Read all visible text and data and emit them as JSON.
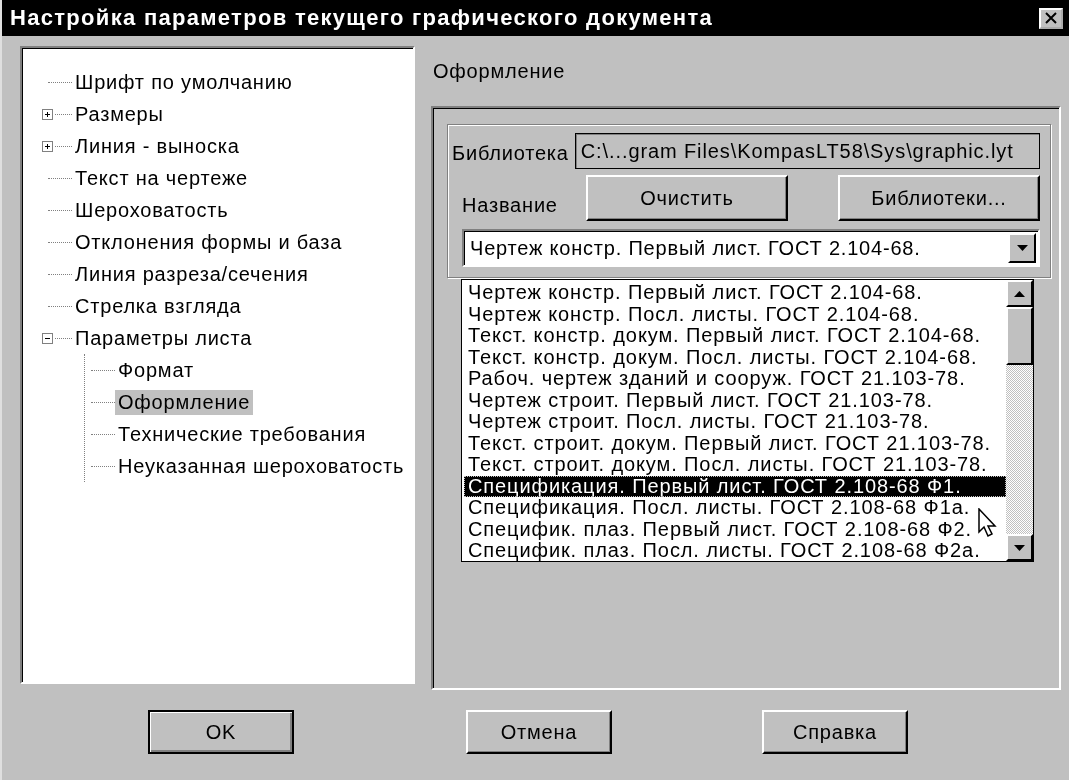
{
  "window": {
    "title": "Настройка параметров текущего графического документа"
  },
  "tree": {
    "items": [
      {
        "label": "Шрифт по умолчанию",
        "kind": "leaf",
        "selected": false
      },
      {
        "label": "Размеры",
        "kind": "group",
        "expanded": false,
        "selected": false
      },
      {
        "label": "Линия - выноска",
        "kind": "group",
        "expanded": false,
        "selected": false
      },
      {
        "label": "Текст на чертеже",
        "kind": "leaf",
        "selected": false
      },
      {
        "label": "Шероховатость",
        "kind": "leaf",
        "selected": false
      },
      {
        "label": "Отклонения формы и база",
        "kind": "leaf",
        "selected": false
      },
      {
        "label": "Линия разреза/сечения",
        "kind": "leaf",
        "selected": false
      },
      {
        "label": "Стрелка взгляда",
        "kind": "leaf",
        "selected": false
      },
      {
        "label": "Параметры листа",
        "kind": "group",
        "expanded": true,
        "selected": false,
        "children": [
          {
            "label": "Формат",
            "kind": "leaf",
            "selected": false
          },
          {
            "label": "Оформление",
            "kind": "leaf",
            "selected": true
          },
          {
            "label": "Технические требования",
            "kind": "leaf",
            "selected": false
          },
          {
            "label": "Неуказанная шероховатость",
            "kind": "leaf",
            "selected": false
          }
        ]
      }
    ]
  },
  "panel": {
    "title": "Оформление",
    "library_label": "Библиотека",
    "library_path": "C:\\...gram Files\\KompasLT58\\Sys\\graphic.lyt",
    "name_label": "Название",
    "buttons": [
      "Очистить",
      "Библиотеки..."
    ],
    "combo": {
      "value": "Чертеж констр. Первый лист. ГОСТ 2.104-68."
    },
    "dropdown": [
      {
        "label": "Чертеж констр. Первый лист. ГОСТ 2.104-68.",
        "selected": false
      },
      {
        "label": "Чертеж констр. Посл. листы. ГОСТ 2.104-68.",
        "selected": false
      },
      {
        "label": "Текст. констр. докум. Первый лист. ГОСТ 2.104-68.",
        "selected": false
      },
      {
        "label": "Текст. констр. докум. Посл. листы. ГОСТ 2.104-68.",
        "selected": false
      },
      {
        "label": "Рабоч. чертеж зданий и сооруж. ГОСТ 21.103-78.",
        "selected": false
      },
      {
        "label": "Чертеж строит. Первый лист. ГОСТ 21.103-78.",
        "selected": false
      },
      {
        "label": "Чертеж строит. Посл. листы.  ГОСТ 21.103-78.",
        "selected": false
      },
      {
        "label": "Текст. строит. докум. Первый лист. ГОСТ 21.103-78.",
        "selected": false
      },
      {
        "label": "Текст. строит. докум. Посл. листы. ГОСТ 21.103-78.",
        "selected": false
      },
      {
        "label": "Спецификация. Первый лист. ГОСТ 2.108-68 Ф1.",
        "selected": true
      },
      {
        "label": "Спецификация. Посл. листы. ГОСТ 2.108-68 Ф1а.",
        "selected": false
      },
      {
        "label": "Специфик. плаз. Первый лист. ГОСТ 2.108-68 Ф2.",
        "selected": false
      },
      {
        "label": "Специфик. плаз. Посл. листы. ГОСТ 2.108-68 Ф2а.",
        "selected": false
      }
    ]
  },
  "buttons": [
    "OK",
    "Отмена",
    "Справка"
  ]
}
